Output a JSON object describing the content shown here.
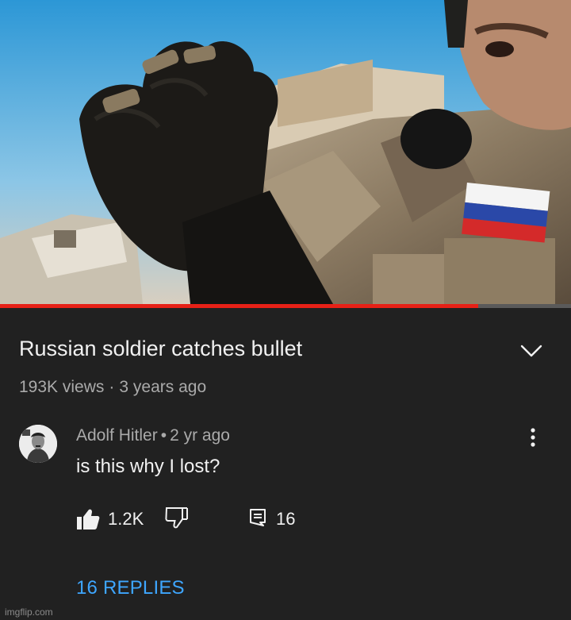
{
  "video": {
    "title": "Russian soldier catches bullet",
    "views": "193K views",
    "age": "3 years ago",
    "progress_fraction": 0.838
  },
  "comment": {
    "author": "Adolf Hitler",
    "posted": "2 yr ago",
    "text": "is this why I lost?",
    "likes": "1.2K",
    "reply_count": "16",
    "replies_link": "16 REPLIES"
  },
  "icons": {
    "expand": "chevron-down-icon",
    "menu": "more-vertical-icon",
    "like": "thumb-up-icon",
    "dislike": "thumb-down-icon",
    "reply": "comment-icon"
  },
  "colors": {
    "background": "#212121",
    "progress": "#e62117",
    "link": "#3ea6ff",
    "secondary_text": "#aaaaaa"
  },
  "watermark": "imgflip.com"
}
